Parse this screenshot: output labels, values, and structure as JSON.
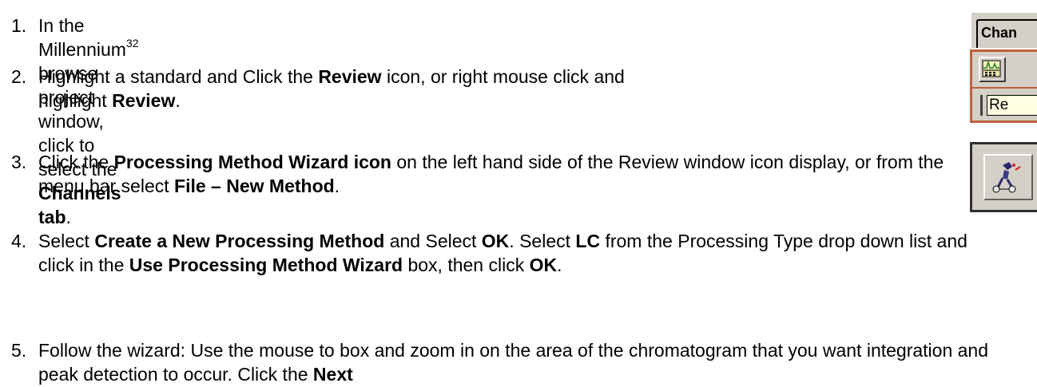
{
  "steps": [
    {
      "number": "1.",
      "parts": [
        {
          "text": "In the Millennium",
          "bold": false
        },
        {
          "text": "32",
          "sup": true
        },
        {
          "text": " browse project window, click to select the ",
          "bold": false
        },
        {
          "text": "Channels tab",
          "bold": true
        },
        {
          "text": ".",
          "bold": false
        }
      ]
    },
    {
      "number": "2.",
      "parts": [
        {
          "text": "Highlight a standard and Click the ",
          "bold": false
        },
        {
          "text": "Review",
          "bold": true
        },
        {
          "text": " icon, or right mouse click and highlight ",
          "bold": false
        },
        {
          "text": "Review",
          "bold": true
        },
        {
          "text": ".",
          "bold": false
        }
      ]
    },
    {
      "number": "3.",
      "parts": [
        {
          "text": " Click the ",
          "bold": false
        },
        {
          "text": "Processing Method Wizard icon",
          "bold": true
        },
        {
          "text": " on the left hand side of the Review window icon display, or from the menu bar select ",
          "bold": false
        },
        {
          "text": "File – New Method",
          "bold": true
        },
        {
          "text": ".",
          "bold": false
        }
      ]
    },
    {
      "number": "4.",
      "parts": [
        {
          "text": "Select ",
          "bold": false
        },
        {
          "text": "Create a New Processing Method",
          "bold": true
        },
        {
          "text": " and Select ",
          "bold": false
        },
        {
          "text": "OK",
          "bold": true
        },
        {
          "text": ". Select ",
          "bold": false
        },
        {
          "text": "LC",
          "bold": true
        },
        {
          "text": " from the Processing Type drop down list and click in the ",
          "bold": false
        },
        {
          "text": "Use Processing Method Wizard",
          "bold": true
        },
        {
          "text": " box, then click ",
          "bold": false
        },
        {
          "text": "OK",
          "bold": true
        },
        {
          "text": ".",
          "bold": false
        }
      ]
    },
    {
      "number": "5.",
      "parts": [
        {
          "text": "Follow the wizard: Use the mouse to box and zoom in on the area of the chromatogram that you want integration and peak detection to occur. Click the ",
          "bold": false
        },
        {
          "text": "Next",
          "bold": true
        }
      ]
    }
  ],
  "screenshots": {
    "channels_tab_label": "Chan",
    "review_tooltip_label": "Re",
    "review_icon": "review-chromatogram-icon",
    "wizard_icon": "processing-method-wizard-icon",
    "colors": {
      "window_gray": "#d4d0c8",
      "highlight_border": "#c0603c",
      "tooltip_bg": "#ffffe1"
    }
  }
}
